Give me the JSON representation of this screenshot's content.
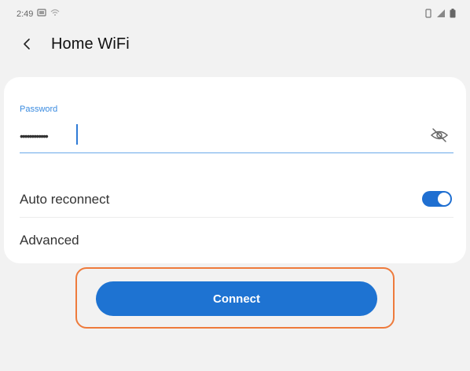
{
  "status_bar": {
    "time": "2:49",
    "icons": [
      "sim-icon",
      "wifi-status-icon",
      "battery-icon"
    ]
  },
  "header": {
    "back_icon": "chevron-left-icon",
    "title": "Home WiFi"
  },
  "password": {
    "label": "Password",
    "value": "••••••••••••",
    "visibility_icon": "eye-off-icon"
  },
  "auto_reconnect": {
    "label": "Auto reconnect",
    "enabled": true
  },
  "advanced": {
    "label": "Advanced"
  },
  "connect": {
    "label": "Connect"
  },
  "colors": {
    "accent": "#1e73d2",
    "label_blue": "#3a8be0",
    "highlight": "#ee7b3c",
    "background": "#f2f2f2",
    "card": "#ffffff"
  }
}
